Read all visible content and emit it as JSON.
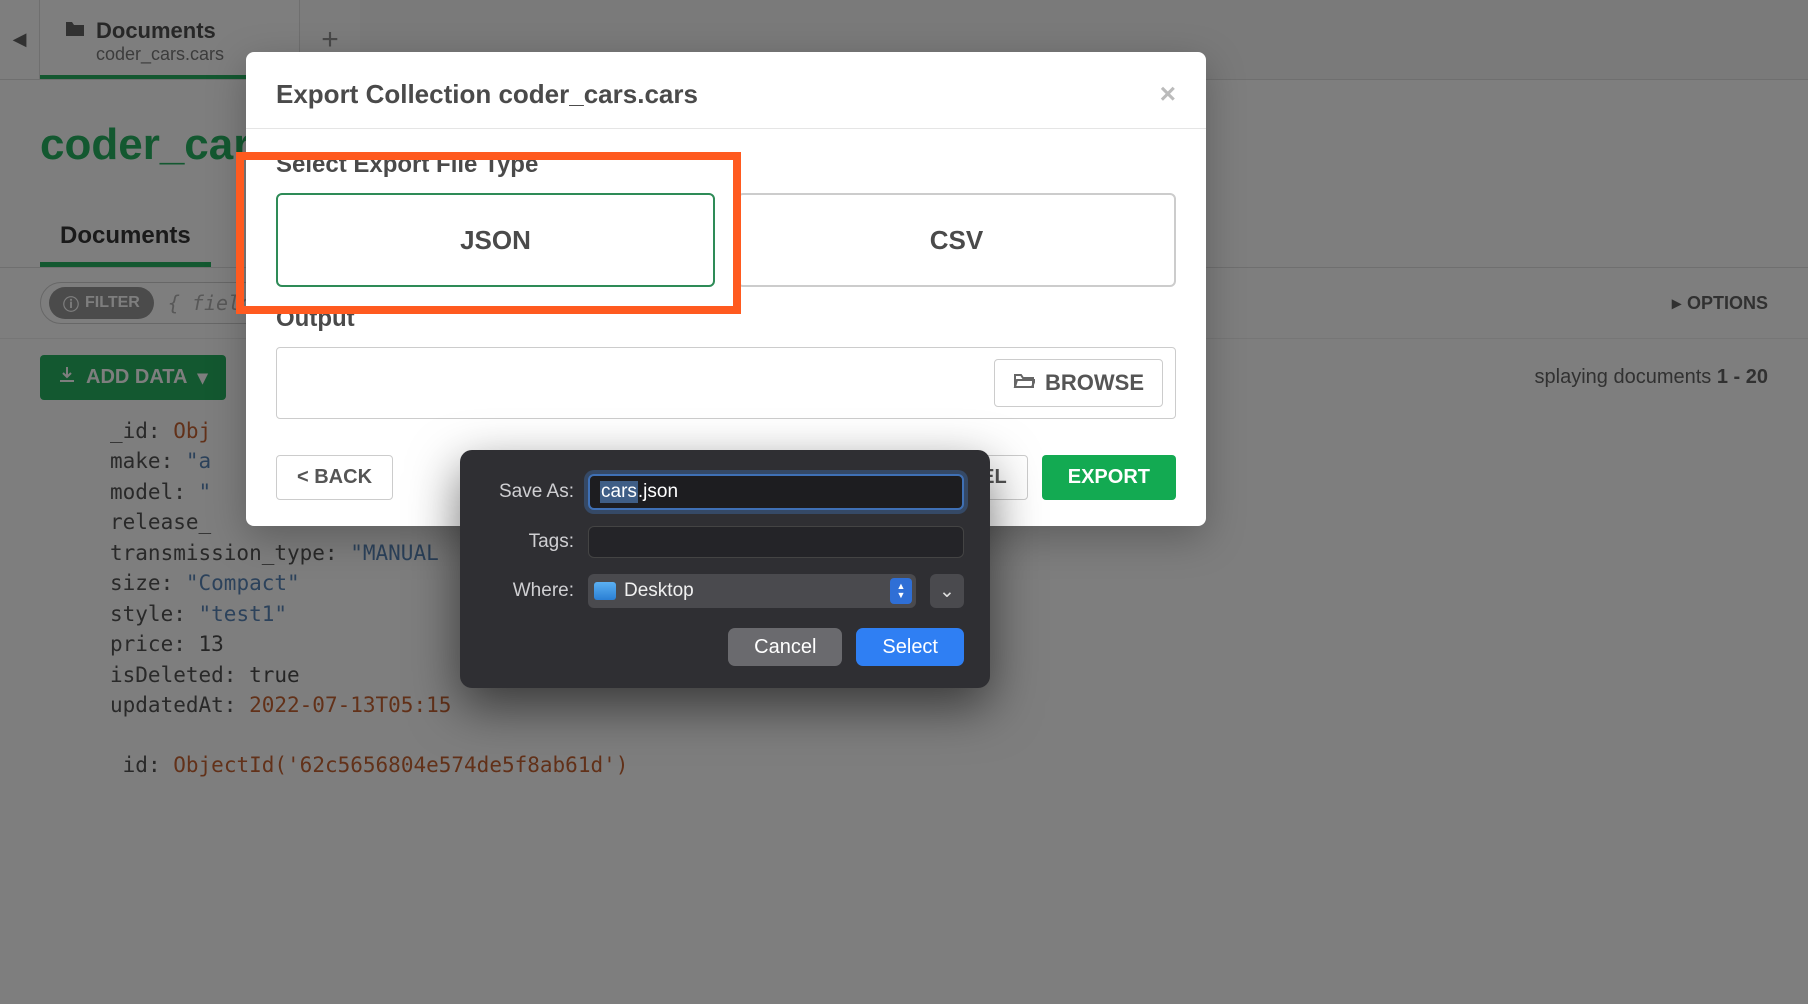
{
  "tab": {
    "title": "Documents",
    "subtitle": "coder_cars.cars"
  },
  "page_title_visible": "coder_cars.",
  "subtabs": {
    "documents": "Documents"
  },
  "filter": {
    "pill": "FILTER",
    "placeholder": "{ field:",
    "options": "OPTIONS"
  },
  "toolbar": {
    "add_data": "ADD DATA",
    "display_info_prefix": "splaying documents ",
    "display_info_bold": "1 - 20"
  },
  "doc1": {
    "l1_key": "_id:",
    "l1_val": "Obj",
    "l2_key": "make:",
    "l2_val": "\"a",
    "l3_key": "model:",
    "l3_val": "\"",
    "l4_key": "release_",
    "l5_key": "transmission_type:",
    "l5_val": "\"MANUAL",
    "l6_key": "size:",
    "l6_val": "\"Compact\"",
    "l7_key": "style:",
    "l7_val": "\"test1\"",
    "l8_key": "price:",
    "l8_val": "13",
    "l9_key": "isDeleted:",
    "l9_val": "true",
    "l10_key": "updatedAt:",
    "l10_val": "2022-07-13T05:15"
  },
  "doc2": {
    "l1_key": "id:",
    "l1_val": "ObjectId('62c5656804e574de5f8ab61d')"
  },
  "export_modal": {
    "title": "Export Collection coder_cars.cars",
    "select_label": "Select Export File Type",
    "json": "JSON",
    "csv": "CSV",
    "output_label": "Output",
    "browse": "BROWSE",
    "back": "< BACK",
    "cancel": "CANCEL",
    "export": "EXPORT"
  },
  "save_sheet": {
    "save_as_label": "Save As:",
    "filename_sel": "cars",
    "filename_rest": ".json",
    "tags_label": "Tags:",
    "where_label": "Where:",
    "where_value": "Desktop",
    "cancel": "Cancel",
    "select": "Select"
  }
}
